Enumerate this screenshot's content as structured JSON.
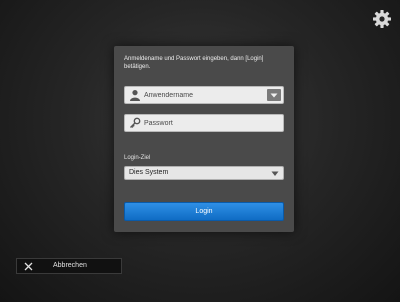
{
  "settings": {
    "icon": "gear-icon"
  },
  "login_panel": {
    "instruction": "Anmeldename und Passwort eingeben, dann [Login] betätigen.",
    "username": {
      "placeholder": "Anwendername",
      "value": "",
      "icon": "user-icon"
    },
    "password": {
      "placeholder": "Passwort",
      "value": "",
      "icon": "key-icon"
    },
    "target_label": "Login-Ziel",
    "target_value": "Dies System",
    "login_label": "Login"
  },
  "cancel": {
    "label": "Abbrechen",
    "icon": "close-icon"
  },
  "colors": {
    "accent": "#1a7bd6",
    "panel": "#4a4a4a",
    "background": "#262626"
  }
}
